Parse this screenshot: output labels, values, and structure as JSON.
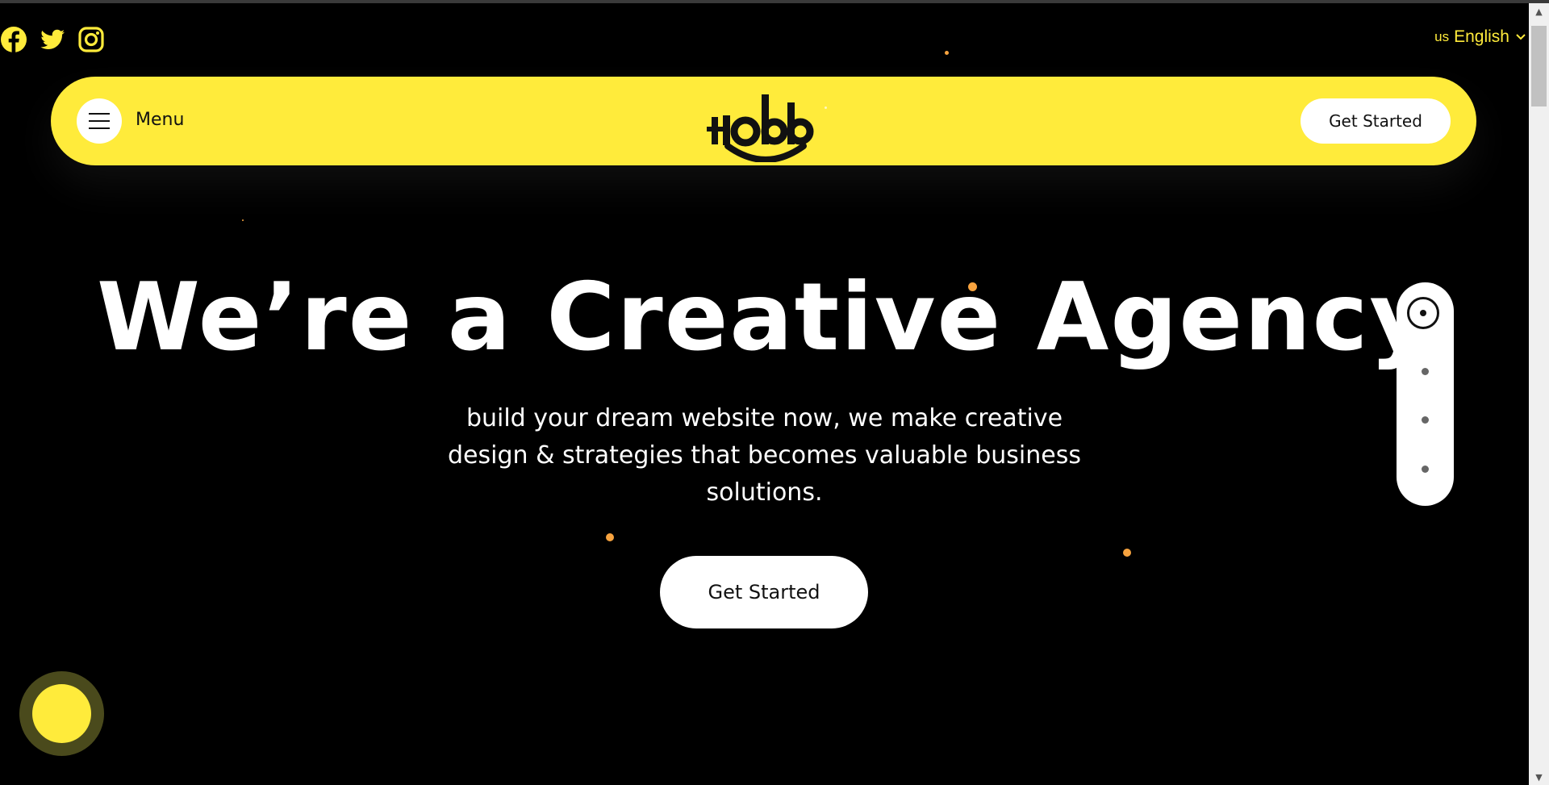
{
  "social": {
    "icons": [
      "facebook-icon",
      "twitter-icon",
      "instagram-icon"
    ],
    "color": "#ffeb3b"
  },
  "language": {
    "flag": "us",
    "label": "English"
  },
  "navbar": {
    "menu_label": "Menu",
    "logo_text": "Hobb",
    "cta_label": "Get Started",
    "background": "#ffeb3b"
  },
  "hero": {
    "title": "We’re a Creative Agency",
    "subtitle": "build your dream website now, we make creative design & strategies that becomes valuable business solutions.",
    "cta_label": "Get Started"
  },
  "scroll_indicator": {
    "sections": 4,
    "active_index": 0
  },
  "colors": {
    "accent": "#ffeb3b",
    "background": "#000000",
    "particle": "#f7a33f"
  }
}
